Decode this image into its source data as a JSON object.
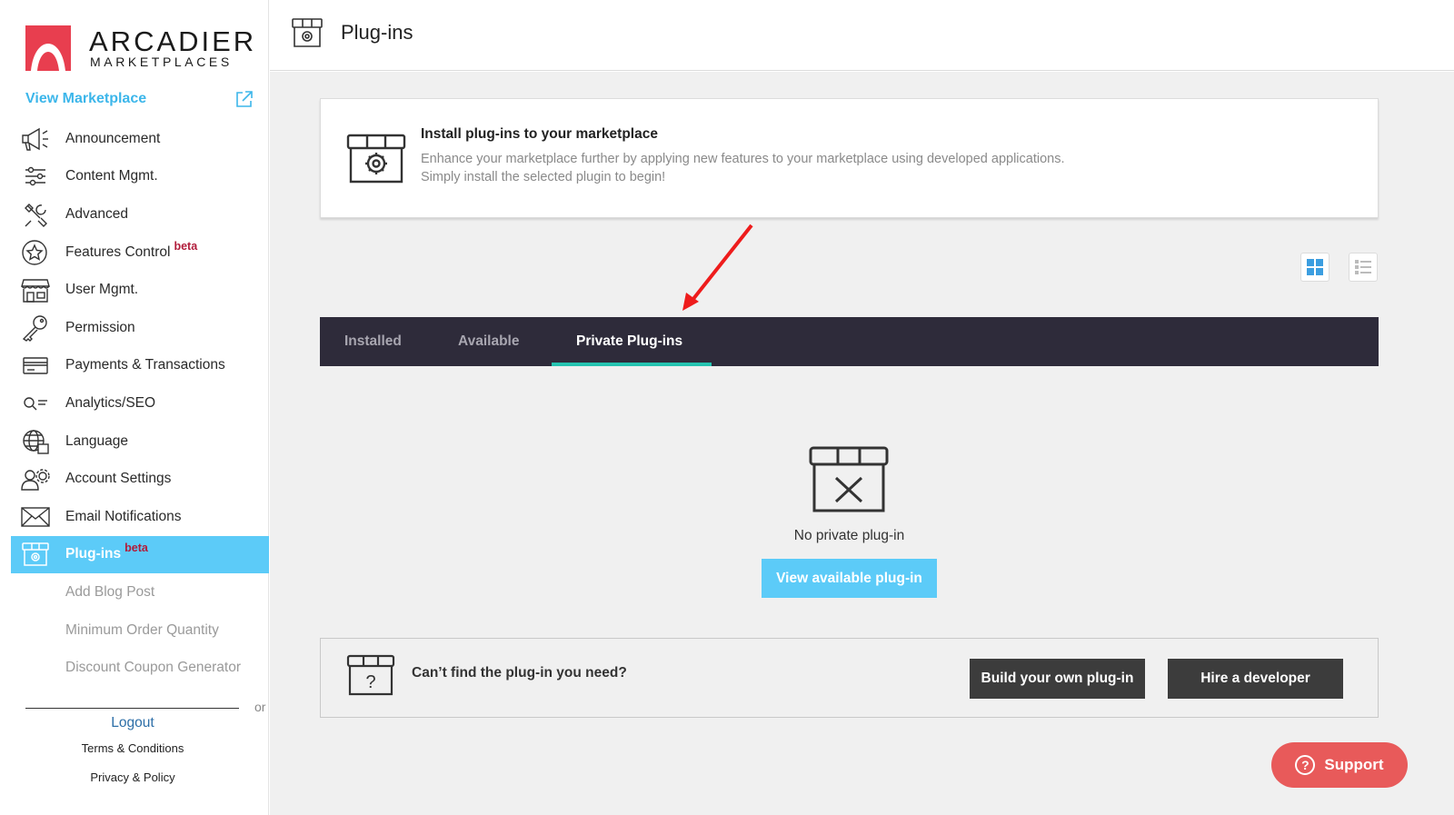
{
  "brand": {
    "name": "ARCADIER",
    "sub": "MARKETPLACES",
    "accent": "#e83e4f"
  },
  "sidebar": {
    "view_marketplace": "View Marketplace",
    "items": [
      {
        "label": "Announcement",
        "icon": "megaphone-icon"
      },
      {
        "label": "Content Mgmt.",
        "icon": "sliders-icon"
      },
      {
        "label": "Advanced",
        "icon": "tools-icon"
      },
      {
        "label": "Features Control",
        "icon": "star-icon",
        "badge": "beta"
      },
      {
        "label": "User Mgmt.",
        "icon": "storefront-icon"
      },
      {
        "label": "Permission",
        "icon": "key-icon"
      },
      {
        "label": "Payments & Transactions",
        "icon": "card-icon"
      },
      {
        "label": "Analytics/SEO",
        "icon": "search-list-icon"
      },
      {
        "label": "Language",
        "icon": "globe-icon"
      },
      {
        "label": "Account Settings",
        "icon": "users-gear-icon"
      },
      {
        "label": "Email Notifications",
        "icon": "envelope-icon"
      },
      {
        "label": "Plug-ins",
        "icon": "plugin-box-icon",
        "badge": "beta",
        "active": true
      }
    ],
    "sub_items": [
      "Add Blog Post",
      "Minimum Order Quantity",
      "Discount Coupon Generator"
    ],
    "divider_text": "or",
    "logout": "Logout",
    "terms": "Terms & Conditions",
    "privacy": "Privacy & Policy"
  },
  "header": {
    "title": "Plug-ins"
  },
  "install_card": {
    "title": "Install plug-ins to your marketplace",
    "desc_line1": "Enhance your marketplace further by applying new features to your marketplace using developed applications.",
    "desc_line2": "Simply install the selected plugin to begin!"
  },
  "tabs": [
    {
      "label": "Installed"
    },
    {
      "label": "Available"
    },
    {
      "label": "Private Plug-ins",
      "active": true
    }
  ],
  "empty_state": {
    "text": "No private plug-in",
    "button": "View available plug-in"
  },
  "cant_find": {
    "text": "Can’t find the plug-in you need?",
    "build_button": "Build your own plug-in",
    "hire_button": "Hire a developer"
  },
  "support": {
    "label": "Support"
  },
  "colors": {
    "active_blue": "#5ccbf8",
    "tab_bar": "#2e2b3a",
    "tab_underline": "#25c3b0",
    "beta_red": "#b11c3a",
    "support_red": "#e85a5a"
  }
}
